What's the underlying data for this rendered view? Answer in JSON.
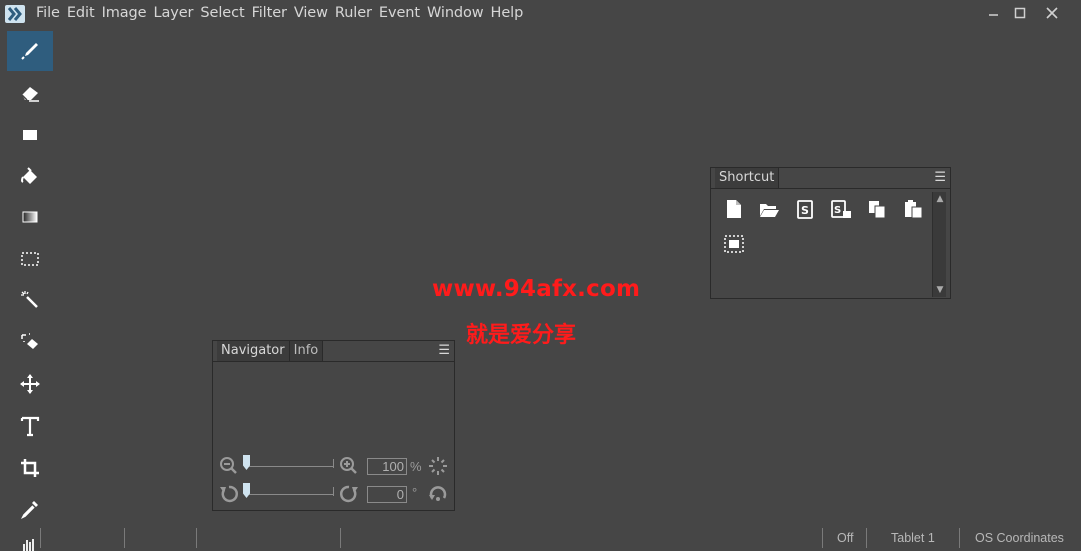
{
  "menu": {
    "items": [
      "File",
      "Edit",
      "Image",
      "Layer",
      "Select",
      "Filter",
      "View",
      "Ruler",
      "Event",
      "Window",
      "Help"
    ]
  },
  "window_controls": {
    "minimize": "—",
    "maximize": "☐",
    "close": "✕"
  },
  "tools": [
    {
      "name": "brush-tool",
      "icon": "brush-icon",
      "active": true
    },
    {
      "name": "eraser-tool",
      "icon": "eraser-icon",
      "active": false
    },
    {
      "name": "shape-tool",
      "icon": "rectangle-icon",
      "active": false
    },
    {
      "name": "fill-tool",
      "icon": "paint-bucket-icon",
      "active": false
    },
    {
      "name": "gradient-tool",
      "icon": "gradient-icon",
      "active": false
    },
    {
      "name": "marquee-tool",
      "icon": "marquee-icon",
      "active": false
    },
    {
      "name": "magic-wand-tool",
      "icon": "magic-wand-icon",
      "active": false
    },
    {
      "name": "selection-eraser-tool",
      "icon": "selection-eraser-icon",
      "active": false
    },
    {
      "name": "move-tool",
      "icon": "move-icon",
      "active": false
    },
    {
      "name": "text-tool",
      "icon": "text-icon",
      "active": false
    },
    {
      "name": "crop-tool",
      "icon": "crop-icon",
      "active": false
    },
    {
      "name": "eyedropper-tool",
      "icon": "eyedropper-icon",
      "active": false
    }
  ],
  "shortcut_panel": {
    "tab": "Shortcut",
    "menu": "☰",
    "icons": [
      "new-file-icon",
      "open-folder-icon",
      "save-icon",
      "save-as-icon",
      "copy-icon",
      "paste-icon",
      "select-all-icon"
    ]
  },
  "navigator_panel": {
    "tabs": [
      "Navigator",
      "Info"
    ],
    "menu": "☰",
    "zoom_value": "100",
    "zoom_unit": "%",
    "rotation_value": "0",
    "rotation_unit": "°"
  },
  "watermark": {
    "site": "www.94afx.com",
    "slogan": "就是爱分享"
  },
  "statusbar": {
    "toggle": "Off",
    "tablet": "Tablet 1",
    "coords": "OS Coordinates"
  },
  "colors": {
    "background": "#464646",
    "accent": "#2f5d7e",
    "watermark": "#ff1b1b"
  }
}
